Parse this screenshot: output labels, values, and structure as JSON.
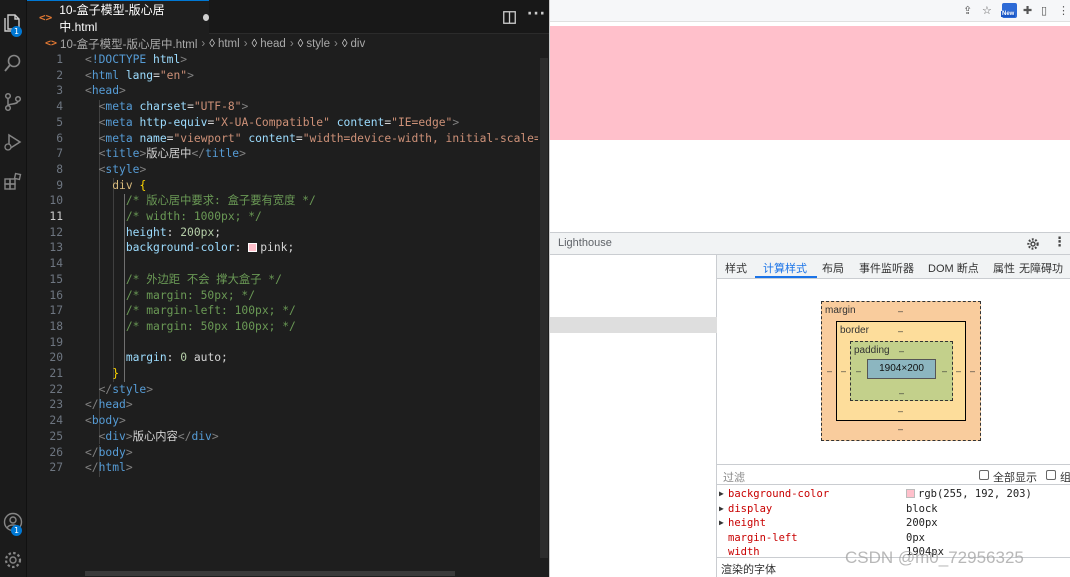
{
  "editor": {
    "tab_label": "10-盒子模型-版心居中.html",
    "file_icon": "<>",
    "breadcrumb": [
      "10-盒子模型-版心居中.html",
      "html",
      "head",
      "style",
      "div"
    ],
    "badges": {
      "explorer": "1",
      "account": "1"
    },
    "active_line": "11",
    "lines": [
      {
        "n": "1",
        "tokens": [
          [
            "c-br",
            "<"
          ],
          [
            "c-tag",
            "!DOCTYPE"
          ],
          [
            "c-text",
            " "
          ],
          [
            "c-attr",
            "html"
          ],
          [
            "c-br",
            ">"
          ]
        ]
      },
      {
        "n": "2",
        "tokens": [
          [
            "c-br",
            "<"
          ],
          [
            "c-tag",
            "html"
          ],
          [
            "c-text",
            " "
          ],
          [
            "c-attr",
            "lang"
          ],
          [
            "c-text",
            "="
          ],
          [
            "c-str",
            "\"en\""
          ],
          [
            "c-br",
            ">"
          ]
        ]
      },
      {
        "n": "3",
        "tokens": [
          [
            "c-br",
            "<"
          ],
          [
            "c-tag",
            "head"
          ],
          [
            "c-br",
            ">"
          ]
        ]
      },
      {
        "n": "4",
        "tokens": [
          [
            "c-text",
            "  "
          ],
          [
            "c-br",
            "<"
          ],
          [
            "c-tag",
            "meta"
          ],
          [
            "c-text",
            " "
          ],
          [
            "c-attr",
            "charset"
          ],
          [
            "c-text",
            "="
          ],
          [
            "c-str",
            "\"UTF-8\""
          ],
          [
            "c-br",
            ">"
          ]
        ]
      },
      {
        "n": "5",
        "tokens": [
          [
            "c-text",
            "  "
          ],
          [
            "c-br",
            "<"
          ],
          [
            "c-tag",
            "meta"
          ],
          [
            "c-text",
            " "
          ],
          [
            "c-attr",
            "http-equiv"
          ],
          [
            "c-text",
            "="
          ],
          [
            "c-str",
            "\"X-UA-Compatible\""
          ],
          [
            "c-text",
            " "
          ],
          [
            "c-attr",
            "content"
          ],
          [
            "c-text",
            "="
          ],
          [
            "c-str",
            "\"IE=edge\""
          ],
          [
            "c-br",
            ">"
          ]
        ]
      },
      {
        "n": "6",
        "tokens": [
          [
            "c-text",
            "  "
          ],
          [
            "c-br",
            "<"
          ],
          [
            "c-tag",
            "meta"
          ],
          [
            "c-text",
            " "
          ],
          [
            "c-attr",
            "name"
          ],
          [
            "c-text",
            "="
          ],
          [
            "c-str",
            "\"viewport\""
          ],
          [
            "c-text",
            " "
          ],
          [
            "c-attr",
            "content"
          ],
          [
            "c-text",
            "="
          ],
          [
            "c-str",
            "\"width=device-width, initial-scale=1.0\""
          ],
          [
            "c-br",
            ">"
          ]
        ]
      },
      {
        "n": "7",
        "tokens": [
          [
            "c-text",
            "  "
          ],
          [
            "c-br",
            "<"
          ],
          [
            "c-tag",
            "title"
          ],
          [
            "c-br",
            ">"
          ],
          [
            "c-text",
            "版心居中"
          ],
          [
            "c-br",
            "</"
          ],
          [
            "c-tag",
            "title"
          ],
          [
            "c-br",
            ">"
          ]
        ]
      },
      {
        "n": "8",
        "tokens": [
          [
            "c-text",
            "  "
          ],
          [
            "c-br",
            "<"
          ],
          [
            "c-tag",
            "style"
          ],
          [
            "c-br",
            ">"
          ]
        ]
      },
      {
        "n": "9",
        "tokens": [
          [
            "c-text",
            "    "
          ],
          [
            "c-sel",
            "div"
          ],
          [
            "c-text",
            " "
          ],
          [
            "c-brace",
            "{"
          ]
        ]
      },
      {
        "n": "10",
        "tokens": [
          [
            "c-text",
            "      "
          ],
          [
            "c-com",
            "/* 版心居中要求: 盒子要有宽度 */"
          ]
        ]
      },
      {
        "n": "11",
        "tokens": [
          [
            "c-text",
            "      "
          ],
          [
            "c-com",
            "/* width: 1000px; */"
          ]
        ]
      },
      {
        "n": "12",
        "tokens": [
          [
            "c-text",
            "      "
          ],
          [
            "c-prop",
            "height"
          ],
          [
            "c-text",
            ": "
          ],
          [
            "c-num",
            "200px"
          ],
          [
            "c-text",
            ";"
          ]
        ]
      },
      {
        "n": "13",
        "tokens": [
          [
            "c-text",
            "      "
          ],
          [
            "c-prop",
            "background-color"
          ],
          [
            "c-text",
            ": "
          ],
          [
            "swatch",
            ""
          ],
          [
            "c-text",
            "pink;"
          ]
        ]
      },
      {
        "n": "14",
        "tokens": []
      },
      {
        "n": "15",
        "tokens": [
          [
            "c-text",
            "      "
          ],
          [
            "c-com",
            "/* 外边距 不会 撑大盒子 */"
          ]
        ]
      },
      {
        "n": "16",
        "tokens": [
          [
            "c-text",
            "      "
          ],
          [
            "c-com",
            "/* margin: 50px; */"
          ]
        ]
      },
      {
        "n": "17",
        "tokens": [
          [
            "c-text",
            "      "
          ],
          [
            "c-com",
            "/* margin-left: 100px; */"
          ]
        ]
      },
      {
        "n": "18",
        "tokens": [
          [
            "c-text",
            "      "
          ],
          [
            "c-com",
            "/* margin: 50px 100px; */"
          ]
        ]
      },
      {
        "n": "19",
        "tokens": []
      },
      {
        "n": "20",
        "tokens": [
          [
            "c-text",
            "      "
          ],
          [
            "c-prop",
            "margin"
          ],
          [
            "c-text",
            ": "
          ],
          [
            "c-num",
            "0"
          ],
          [
            "c-text",
            " auto;"
          ]
        ]
      },
      {
        "n": "21",
        "tokens": [
          [
            "c-text",
            "    "
          ],
          [
            "c-brace",
            "}"
          ]
        ]
      },
      {
        "n": "22",
        "tokens": [
          [
            "c-text",
            "  "
          ],
          [
            "c-br",
            "</"
          ],
          [
            "c-tag",
            "style"
          ],
          [
            "c-br",
            ">"
          ]
        ]
      },
      {
        "n": "23",
        "tokens": [
          [
            "c-br",
            "</"
          ],
          [
            "c-tag",
            "head"
          ],
          [
            "c-br",
            ">"
          ]
        ]
      },
      {
        "n": "24",
        "tokens": [
          [
            "c-br",
            "<"
          ],
          [
            "c-tag",
            "body"
          ],
          [
            "c-br",
            ">"
          ]
        ]
      },
      {
        "n": "25",
        "tokens": [
          [
            "c-text",
            "  "
          ],
          [
            "c-br",
            "<"
          ],
          [
            "c-tag",
            "div"
          ],
          [
            "c-br",
            ">"
          ],
          [
            "c-text",
            "版心内容"
          ],
          [
            "c-br",
            "</"
          ],
          [
            "c-tag",
            "div"
          ],
          [
            "c-br",
            ">"
          ]
        ]
      },
      {
        "n": "26",
        "tokens": [
          [
            "c-br",
            "</"
          ],
          [
            "c-tag",
            "body"
          ],
          [
            "c-br",
            ">"
          ]
        ]
      },
      {
        "n": "27",
        "tokens": [
          [
            "c-br",
            "</"
          ],
          [
            "c-tag",
            "html"
          ],
          [
            "c-br",
            ">"
          ]
        ]
      }
    ]
  },
  "browser": {
    "page_div_color": "#ffc0cb",
    "new_badge": "New"
  },
  "devtools": {
    "lighthouse_label": "Lighthouse",
    "tabs": [
      "样式",
      "计算样式",
      "布局",
      "事件监听器",
      "DOM 断点",
      "属性",
      "无障碍功"
    ],
    "active_tab": "计算样式",
    "box_model": {
      "margin_label": "margin",
      "border_label": "border",
      "padding_label": "padding",
      "content_size": "1904×200",
      "dash": "–"
    },
    "filter_placeholder": "过滤",
    "show_all_label": "全部显示",
    "group_label": "组",
    "computed": [
      {
        "name": "background-color",
        "value": "rgb(255, 192, 203)",
        "expandable": true,
        "swatch": "#ffc0cb"
      },
      {
        "name": "display",
        "value": "block",
        "expandable": true
      },
      {
        "name": "height",
        "value": "200px",
        "expandable": true
      },
      {
        "name": "margin-left",
        "value": "0px",
        "expandable": false
      },
      {
        "name": "width",
        "value": "1904px",
        "expandable": false
      }
    ],
    "rendered_fonts_label": "渲染的字体"
  },
  "watermark": "CSDN @m0_72956325"
}
